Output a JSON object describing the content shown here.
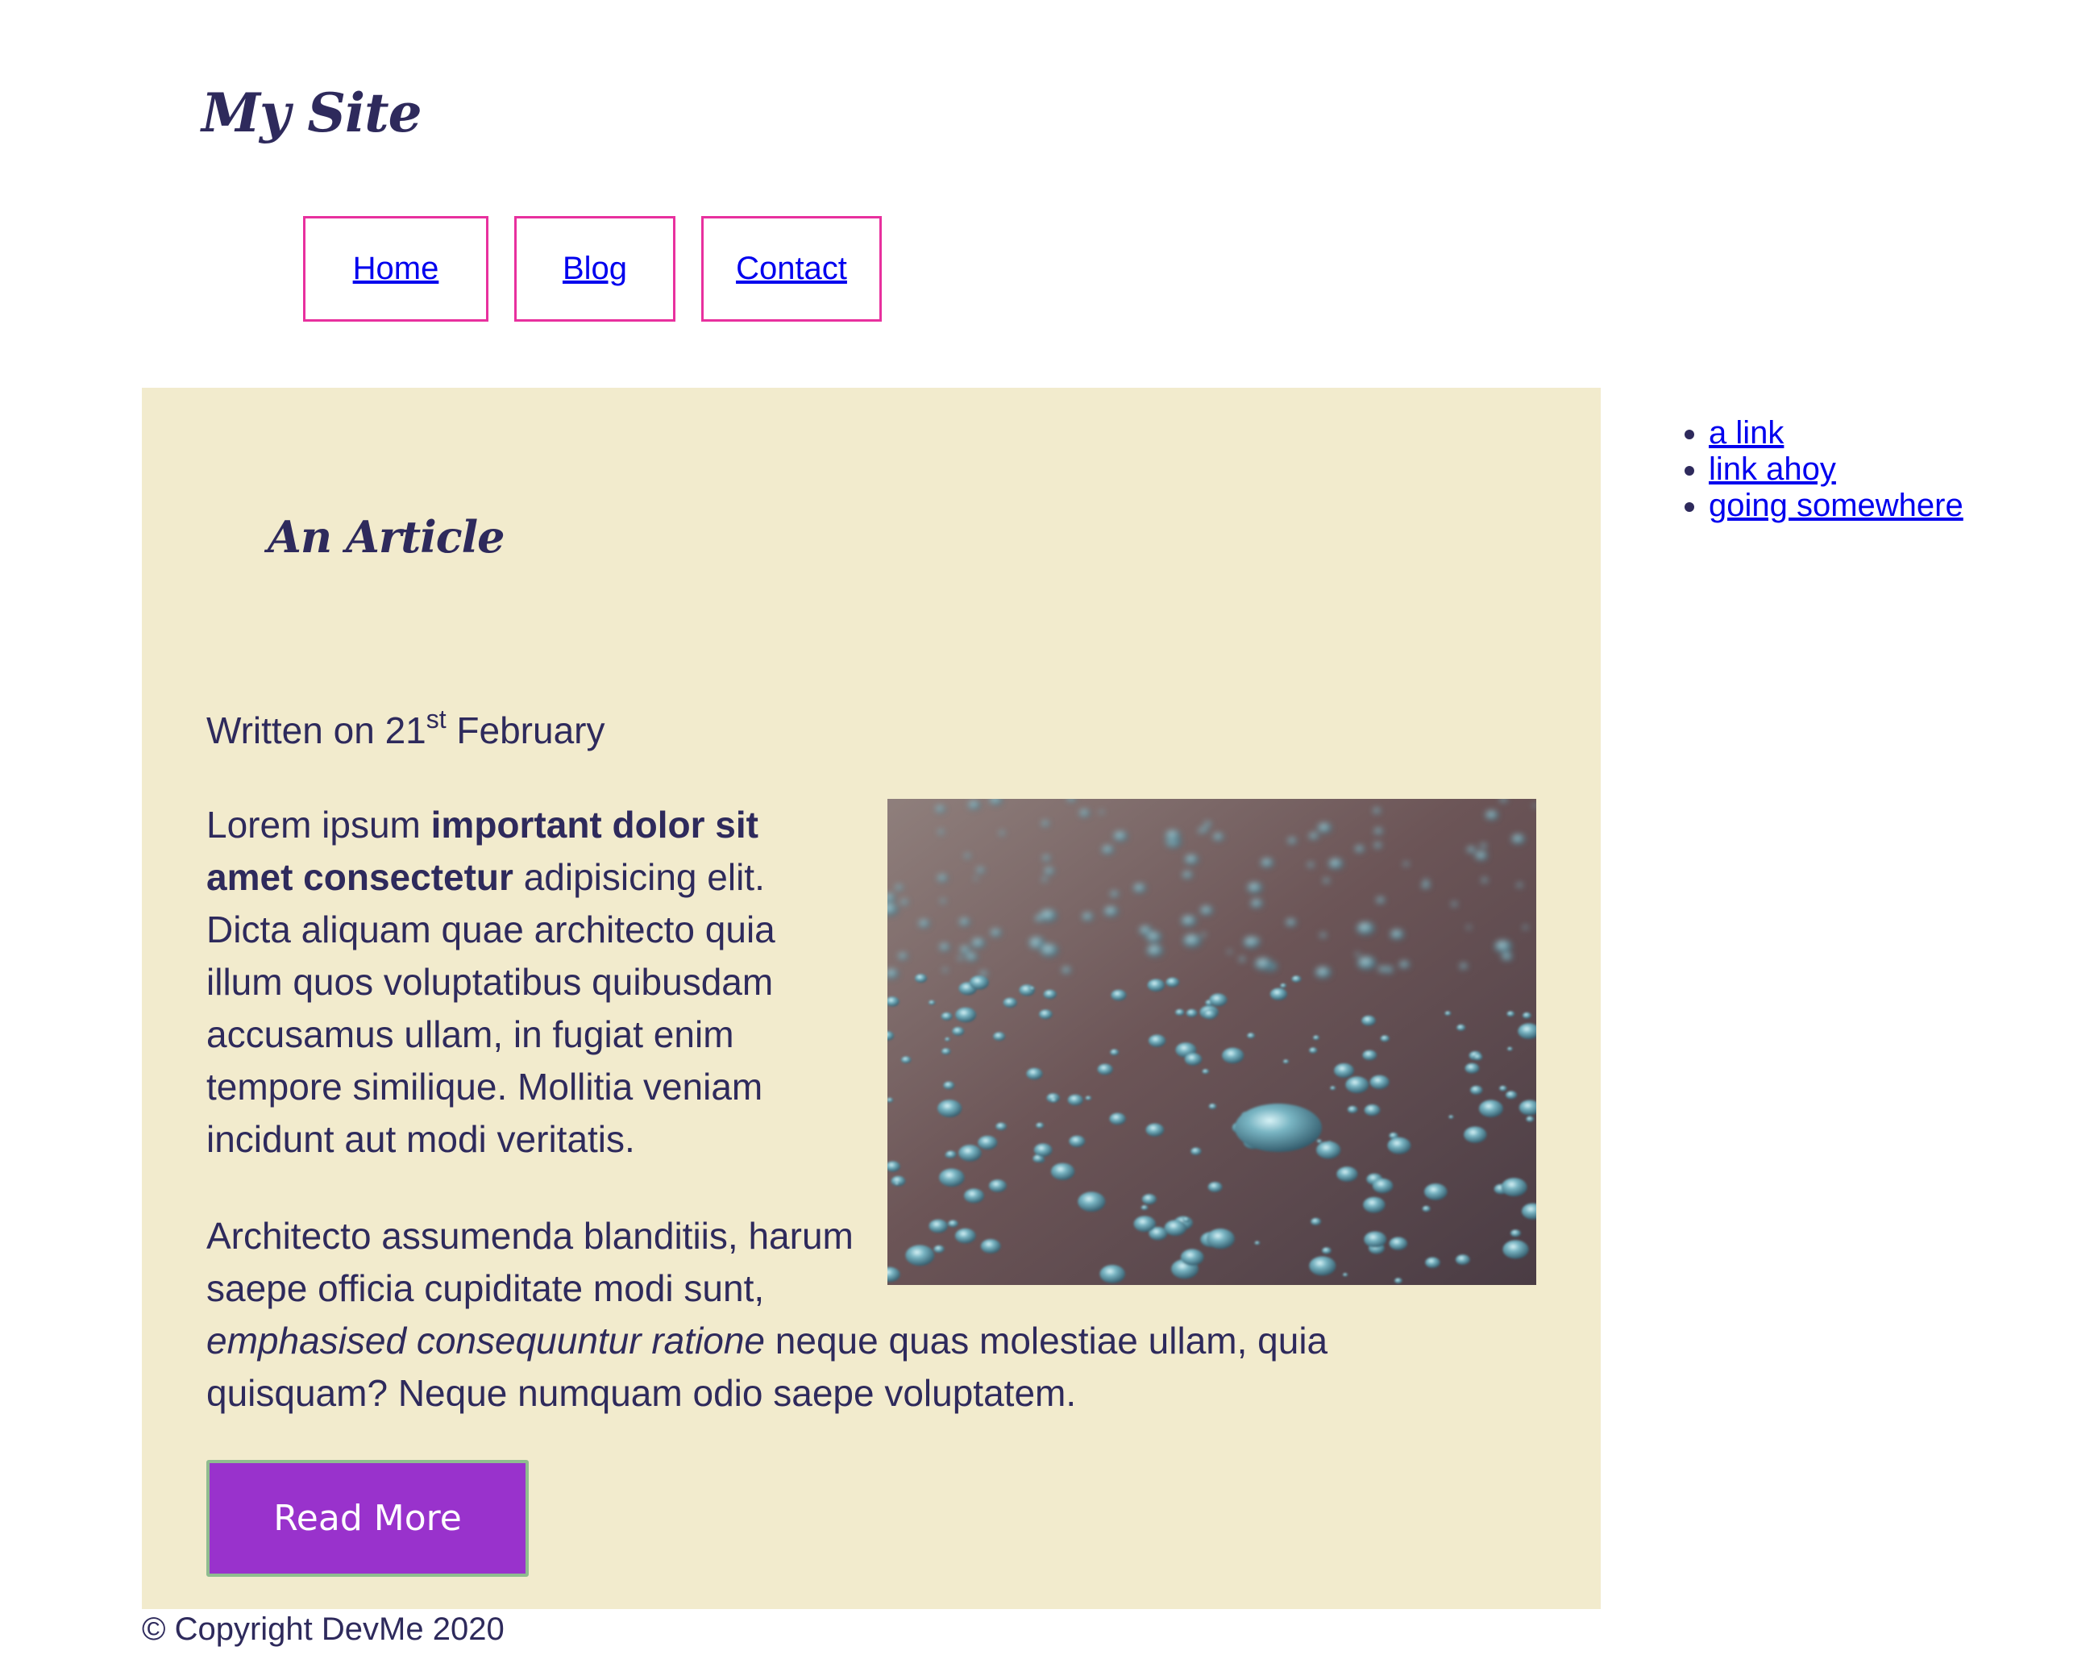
{
  "header": {
    "site_title": "My Site"
  },
  "nav": {
    "items": [
      {
        "label": "Home"
      },
      {
        "label": "Blog"
      },
      {
        "label": "Contact"
      }
    ]
  },
  "article": {
    "title": "An Article",
    "date_prefix": "Written on 21",
    "date_suffix": "st",
    "date_month": " February",
    "para1": {
      "t1": "Lorem ipsum ",
      "strong": "important dolor sit amet consectetur",
      "t2": " adipisicing elit. Dicta aliquam quae architecto quia illum quos voluptatibus quibusdam accusamus ullam, in fugiat enim tempore similique. Mollitia veniam incidunt aut modi veritatis."
    },
    "para2": {
      "t1": "Architecto assumenda blanditiis, harum saepe officia cupiditate modi sunt,",
      "em": "emphasised consequuntur ratione",
      "t2": " neque quas molestiae ullam, quia quisquam? Neque numquam odio saepe voluptatem."
    },
    "button_label": "Read More",
    "image_icon": "water-droplets-photo"
  },
  "sidebar": {
    "links": [
      {
        "label": "a link"
      },
      {
        "label": "link ahoy"
      },
      {
        "label": "going somewhere"
      }
    ]
  },
  "footer": {
    "copyright": "© Copyright DevMe 2020"
  },
  "colors": {
    "text": "#2e2a5c",
    "nav_border": "#e8309e",
    "article_bg": "#f2ebcd",
    "button_bg": "#9932cc",
    "button_border": "#8fbc8f",
    "link": "#0000ee"
  }
}
